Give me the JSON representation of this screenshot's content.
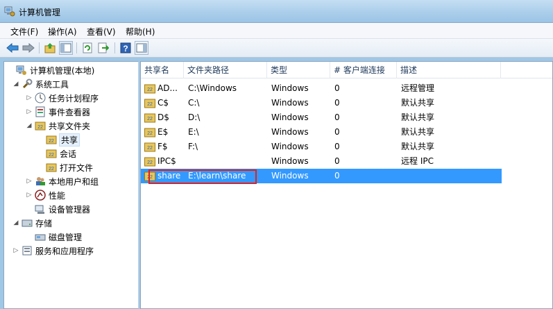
{
  "window": {
    "title": "计算机管理"
  },
  "menu": [
    "文件(F)",
    "操作(A)",
    "查看(V)",
    "帮助(H)"
  ],
  "toolbar": [
    "back-icon",
    "forward-icon",
    "up-folder-icon",
    "show-hide-tree-icon",
    "refresh-icon",
    "export-list-icon",
    "help-icon",
    "action-pane-icon"
  ],
  "tree": [
    {
      "label": "计算机管理(本地)",
      "icon": "computer-management-icon",
      "expander": ""
    },
    {
      "label": "系统工具",
      "icon": "tools-icon",
      "expander": "◢"
    },
    {
      "label": "任务计划程序",
      "icon": "clock-icon",
      "expander": "▷"
    },
    {
      "label": "事件查看器",
      "icon": "event-viewer-icon",
      "expander": "▷"
    },
    {
      "label": "共享文件夹",
      "icon": "shared-folder-icon",
      "expander": "◢"
    },
    {
      "label": "共享",
      "icon": "share-icon",
      "expander": "",
      "selected": true
    },
    {
      "label": "会话",
      "icon": "share-icon",
      "expander": ""
    },
    {
      "label": "打开文件",
      "icon": "share-icon",
      "expander": ""
    },
    {
      "label": "本地用户和组",
      "icon": "users-icon",
      "expander": "▷"
    },
    {
      "label": "性能",
      "icon": "performance-icon",
      "expander": "▷"
    },
    {
      "label": "设备管理器",
      "icon": "device-manager-icon",
      "expander": ""
    },
    {
      "label": "存储",
      "icon": "storage-icon",
      "expander": "◢"
    },
    {
      "label": "磁盘管理",
      "icon": "disk-management-icon",
      "expander": ""
    },
    {
      "label": "服务和应用程序",
      "icon": "services-icon",
      "expander": "▷"
    }
  ],
  "columns": [
    "共享名",
    "文件夹路径",
    "类型",
    "# 客户端连接",
    "描述"
  ],
  "rows": [
    {
      "name": "AD...",
      "path": "C:\\Windows",
      "type": "Windows",
      "clients": "0",
      "desc": "远程管理"
    },
    {
      "name": "C$",
      "path": "C:\\",
      "type": "Windows",
      "clients": "0",
      "desc": "默认共享"
    },
    {
      "name": "D$",
      "path": "D:\\",
      "type": "Windows",
      "clients": "0",
      "desc": "默认共享"
    },
    {
      "name": "E$",
      "path": "E:\\",
      "type": "Windows",
      "clients": "0",
      "desc": "默认共享"
    },
    {
      "name": "F$",
      "path": "F:\\",
      "type": "Windows",
      "clients": "0",
      "desc": "默认共享"
    },
    {
      "name": "IPC$",
      "path": "",
      "type": "Windows",
      "clients": "0",
      "desc": "远程 IPC"
    },
    {
      "name": "share",
      "path": "E:\\learn\\share",
      "type": "Windows",
      "clients": "0",
      "desc": "",
      "selected": true
    }
  ],
  "colors": {
    "selection": "#3399ff",
    "highlight_box": "#e02020"
  }
}
